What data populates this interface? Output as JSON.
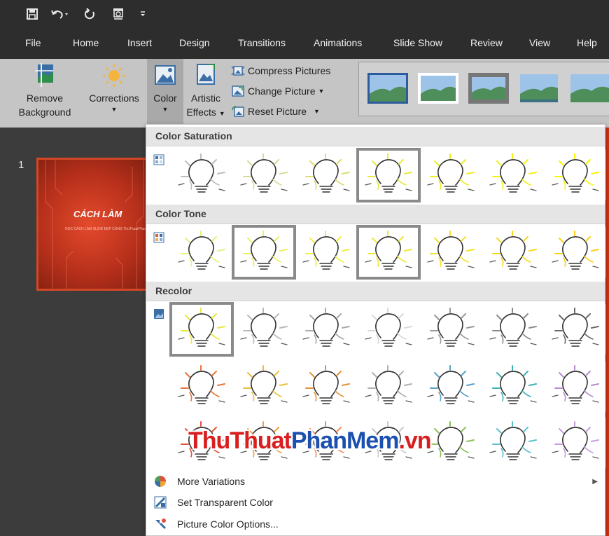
{
  "quick_access": {
    "icons": [
      "save-icon",
      "undo-icon",
      "redo-icon",
      "start-from-beginning-icon",
      "customize-icon"
    ]
  },
  "menu": {
    "items": [
      "File",
      "Home",
      "Insert",
      "Design",
      "Transitions",
      "Animations",
      "Slide Show",
      "Review",
      "View",
      "Help"
    ]
  },
  "ribbon": {
    "remove_background": [
      "Remove",
      "Background"
    ],
    "corrections": "Corrections",
    "color": "Color",
    "artistic_effects": [
      "Artistic",
      "Effects"
    ],
    "compress": "Compress Pictures",
    "change": "Change Picture",
    "reset": "Reset Picture"
  },
  "slides": {
    "number": "1",
    "title": "CÁCH LÀM",
    "subtitle": "HỌC CÁCH LÀM SLIDE ĐẸP CÙNG ThuThuatPhanMem"
  },
  "dropdown": {
    "saturation_header": "Color Saturation",
    "tone_header": "Color Tone",
    "recolor_header": "Recolor",
    "menu_items": [
      {
        "label": "More Variations",
        "icon": "palette-icon",
        "has_submenu": true
      },
      {
        "label": "Set Transparent Color",
        "icon": "transparent-color-icon",
        "has_submenu": false
      },
      {
        "label": "Picture Color Options...",
        "icon": "color-options-icon",
        "has_submenu": false
      }
    ]
  },
  "colors": {
    "saturation": [
      "#bdbdbd",
      "#d8d99a",
      "#dcdc70",
      "#e8e83a",
      "#eded22",
      "#f2f211",
      "#f7f700"
    ],
    "tone": [
      "#e6f07a",
      "#ecf05a",
      "#f0ee40",
      "#efe830",
      "#f3e125",
      "#f6d81c",
      "#fad015"
    ],
    "recolor_row1": [
      "#e8e83a",
      "#b8b8b8",
      "#a8a8a8",
      "#d9d9d9",
      "#999999",
      "#8a8a8a",
      "#6a6a6a"
    ],
    "recolor_row2": [
      "#e8753a",
      "#e8c13a",
      "#e0913a",
      "#b0b0b0",
      "#5aa0c8",
      "#3cb0b8",
      "#b48cd0"
    ],
    "recolor_row3": [
      "#e2503a",
      "#f2a03a",
      "#f08c5a",
      "#c8c8c8",
      "#8cc05a",
      "#5ac0d0",
      "#c89be0"
    ]
  },
  "watermark": {
    "part1": "ThuThuat",
    "part2": "PhanMem",
    "part3": ".vn"
  }
}
